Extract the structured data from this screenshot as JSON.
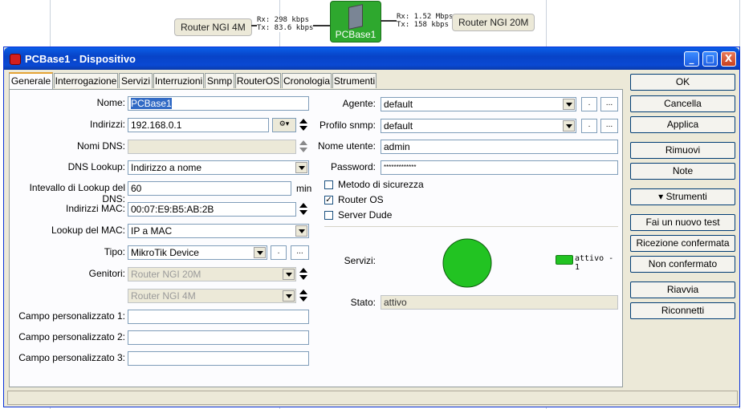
{
  "map": {
    "node_left": "Router NGI 4M",
    "node_right": "Router NGI 20M",
    "node_center": "PCBase1",
    "left_rx": "Rx: 298 kbps",
    "left_tx": "Tx: 83.6 kbps",
    "right_rx": "Rx: 1.52 Mbps",
    "right_tx": "Tx: 158 kbps"
  },
  "window": {
    "title": "PCBase1 - Dispositivo",
    "minimize": "_",
    "maximize": "□",
    "close": "X"
  },
  "tabs": [
    "Generale",
    "Interrogazione",
    "Servizi",
    "Interruzioni",
    "Snmp",
    "RouterOS",
    "Cronologia",
    "Strumenti"
  ],
  "form": {
    "name_label": "Nome:",
    "name_value": "PCBase1",
    "addr_label": "Indirizzi:",
    "addr_value": "192.168.0.1",
    "dns_names_label": "Nomi DNS:",
    "dns_lookup_label": "DNS Lookup:",
    "dns_lookup_value": "Indirizzo a nome",
    "dns_interval_label": "Intevallo di Lookup del DNS:",
    "dns_interval_value": "60",
    "dns_interval_unit": "min",
    "mac_label": "Indirizzi MAC:",
    "mac_value": "00:07:E9:B5:AB:2B",
    "mac_lookup_label": "Lookup del MAC:",
    "mac_lookup_value": "IP a MAC",
    "type_label": "Tipo:",
    "type_value": "MikroTik Device",
    "parents_label": "Genitori:",
    "parent1": "Router NGI 20M",
    "parent2": "Router NGI 4M",
    "custom1_label": "Campo personalizzato 1:",
    "custom2_label": "Campo personalizzato 2:",
    "custom3_label": "Campo personalizzato 3:",
    "agent_label": "Agente:",
    "agent_value": "default",
    "snmp_label": "Profilo snmp:",
    "snmp_value": "default",
    "user_label": "Nome utente:",
    "user_value": "admin",
    "pass_label": "Password:",
    "pass_value": "*************",
    "secure_label": "Metodo di sicurezza",
    "routeros_label": "Router OS",
    "dude_label": "Server Dude",
    "services_label": "Servizi:",
    "legend_label": "attivo - 1",
    "state_label": "Stato:",
    "state_value": "attivo",
    "dots": "...",
    "small": "."
  },
  "buttons": {
    "ok": "OK",
    "cancel": "Cancella",
    "apply": "Applica",
    "remove": "Rimuovi",
    "notes": "Note",
    "tools": "▾ Strumenti",
    "new_test": "Fai un nuovo test",
    "ack": "Ricezione confermata",
    "unack": "Non confermato",
    "reboot": "Riavvia",
    "reconnect": "Riconnetti"
  },
  "colors": {
    "service_active": "#22c322",
    "title_blue": "#0a49d3"
  },
  "chart_data": {
    "type": "pie",
    "categories": [
      "attivo"
    ],
    "values": [
      1
    ]
  }
}
